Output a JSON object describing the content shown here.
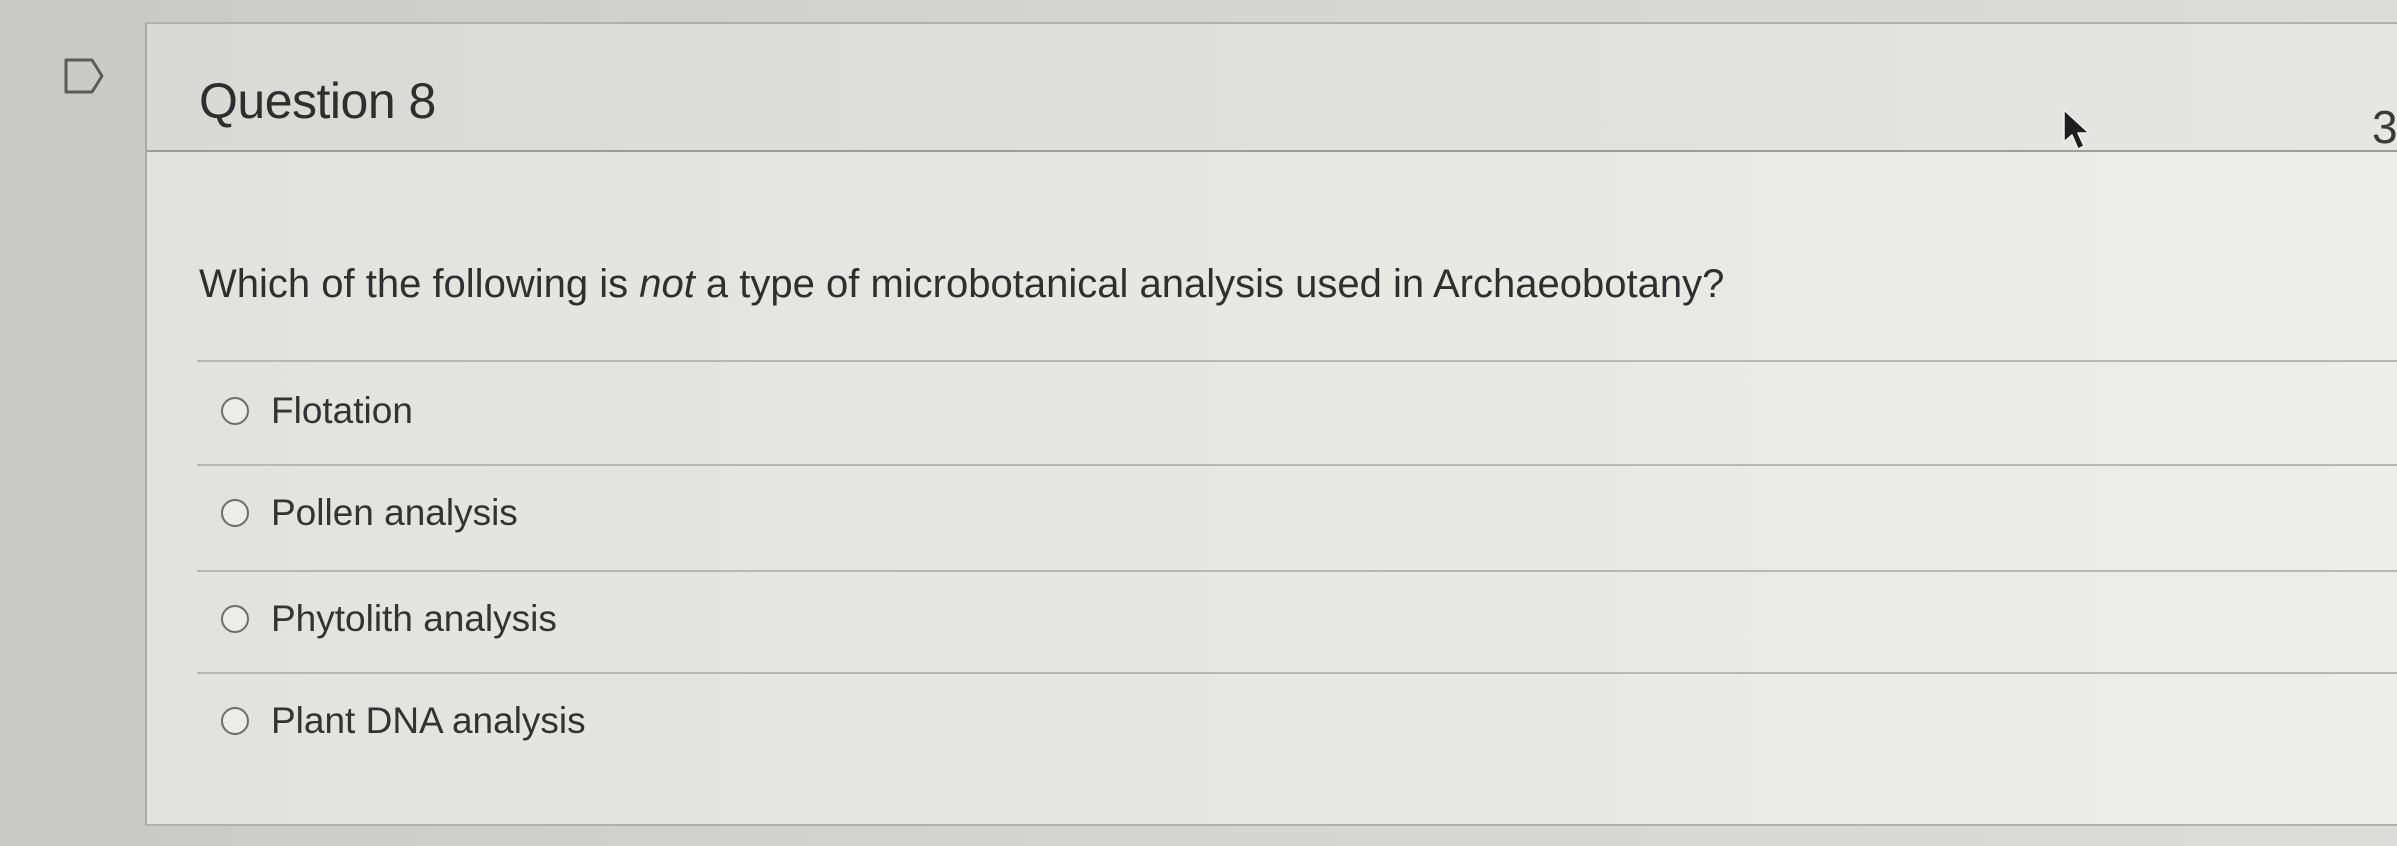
{
  "question": {
    "title": "Question 8",
    "points_fragment": "3",
    "prompt_before": "Which of the following is ",
    "prompt_emphasis": "not",
    "prompt_after": " a type of microbotanical analysis used in Archaeobotany?",
    "options": [
      {
        "label": "Flotation",
        "selected": false
      },
      {
        "label": "Pollen analysis",
        "selected": false
      },
      {
        "label": "Phytolith analysis",
        "selected": false
      },
      {
        "label": "Plant DNA analysis",
        "selected": false
      }
    ]
  },
  "icons": {
    "flag": "flag-outline-icon",
    "cursor": "mouse-pointer-icon",
    "radio": "radio-unselected-icon"
  },
  "colors": {
    "background": "#cfcfcc",
    "card": "#e8e8e5",
    "text": "#2e2e2e",
    "divider": "#b7b7b4"
  }
}
